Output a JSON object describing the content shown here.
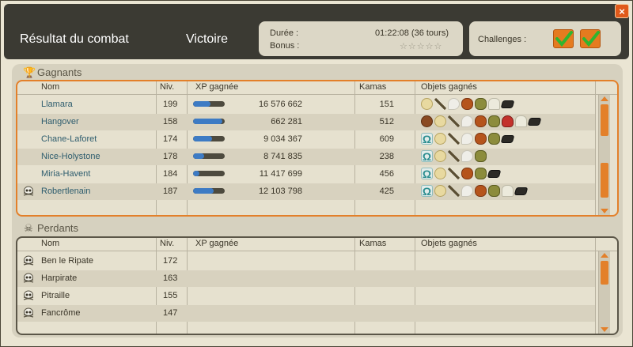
{
  "window": {
    "title": "Résultat du combat",
    "result": "Victoire",
    "close_label": "×"
  },
  "summary": {
    "duration_label": "Durée :",
    "duration_value": "01:22:08 (36 tours)",
    "bonus_label": "Bonus :",
    "bonus_stars": "☆☆☆☆☆",
    "challenges_label": "Challenges :"
  },
  "columns": {
    "name": "Nom",
    "level": "Niv.",
    "xp": "XP gagnée",
    "kamas": "Kamas",
    "items": "Objets gagnés"
  },
  "winners": {
    "title": "Gagnants",
    "rows": [
      {
        "name": "Llamara",
        "level": "199",
        "xp": "16 576 662",
        "xp_fill": 0.55,
        "kamas": "151",
        "items": [
          "seed",
          "stick",
          "feather",
          "meat",
          "shell",
          "glove",
          "black"
        ]
      },
      {
        "name": "Hangover",
        "level": "158",
        "xp": "662 281",
        "xp_fill": 0.92,
        "kamas": "512",
        "items": [
          "nut",
          "seed",
          "stick",
          "feather",
          "meat",
          "shell",
          "mush",
          "glove",
          "black"
        ]
      },
      {
        "name": "Chane-Laforet",
        "level": "174",
        "xp": "9 034 367",
        "xp_fill": 0.6,
        "kamas": "609",
        "items": [
          "omega",
          "seed",
          "stick",
          "feather",
          "meat",
          "shell",
          "black"
        ]
      },
      {
        "name": "Nice-Holystone",
        "level": "178",
        "xp": "8 741 835",
        "xp_fill": 0.35,
        "kamas": "238",
        "items": [
          "omega",
          "seed",
          "stick",
          "feather",
          "shell"
        ]
      },
      {
        "name": "Miria-Havent",
        "level": "184",
        "xp": "11 417 699",
        "xp_fill": 0.2,
        "kamas": "456",
        "items": [
          "omega",
          "seed",
          "stick",
          "meat",
          "shell",
          "black"
        ]
      },
      {
        "name": "Robertlenain",
        "level": "187",
        "xp": "12 103 798",
        "xp_fill": 0.65,
        "kamas": "425",
        "items": [
          "omega",
          "seed",
          "stick",
          "feather",
          "meat",
          "shell",
          "glove",
          "black"
        ],
        "dead": true
      }
    ]
  },
  "losers": {
    "title": "Perdants",
    "rows": [
      {
        "name": "Ben le Ripate",
        "level": "172"
      },
      {
        "name": "Harpirate",
        "level": "163"
      },
      {
        "name": "Pitraille",
        "level": "155"
      },
      {
        "name": "Fancrôme",
        "level": "147"
      }
    ]
  },
  "colors": {
    "accent": "#e3802a",
    "name_link": "#2e5d6e",
    "xp_bar": "#3d7bc4"
  }
}
